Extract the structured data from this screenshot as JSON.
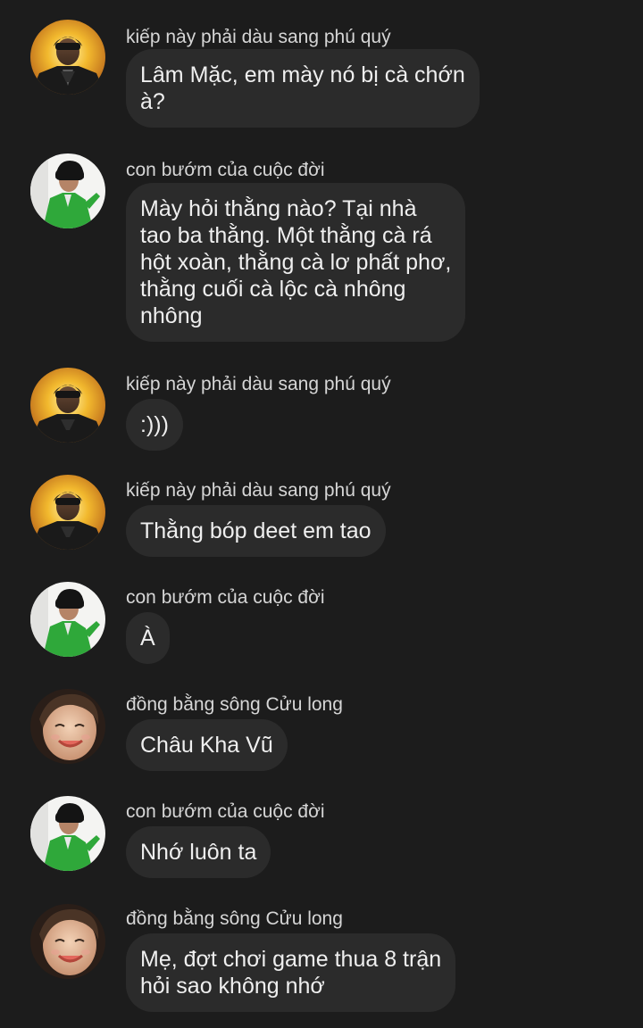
{
  "colors": {
    "background": "#1c1c1c",
    "bubble": "#2b2b2b",
    "text": "#efefef",
    "sender_text": "#d6d6d6"
  },
  "messages": [
    {
      "avatar": "avatar-mustard-jacket",
      "sender": "kiếp này phải dàu sang phú quý",
      "text": "Lâm Mặc, em mày nó bị cà chớn\nà?"
    },
    {
      "avatar": "avatar-green-jacket",
      "sender": "con bướm của cuộc đời",
      "text": "Mày hỏi thằng nào? Tại nhà\ntao ba thằng. Một thằng cà rá\nhột xoàn, thằng cà lơ phất phơ,\nthằng cuối cà lộc cà nhông\nnhông"
    },
    {
      "avatar": "avatar-mustard-jacket",
      "sender": "kiếp này phải dàu sang phú quý",
      "text": ":)))"
    },
    {
      "avatar": "avatar-mustard-jacket",
      "sender": "kiếp này phải dàu sang phú quý",
      "text": "Thằng bóp deet em tao"
    },
    {
      "avatar": "avatar-green-jacket",
      "sender": "con bướm của cuộc đời",
      "text": "À"
    },
    {
      "avatar": "avatar-smiling-face",
      "sender": "đồng bằng sông Cửu long",
      "text": "Châu Kha Vũ"
    },
    {
      "avatar": "avatar-green-jacket",
      "sender": "con bướm của cuộc đời",
      "text": "Nhớ luôn ta"
    },
    {
      "avatar": "avatar-smiling-face",
      "sender": "đồng bằng sông Cửu long",
      "text": "Mẹ, đợt chơi game thua 8 trận\nhỏi sao không nhớ"
    }
  ]
}
